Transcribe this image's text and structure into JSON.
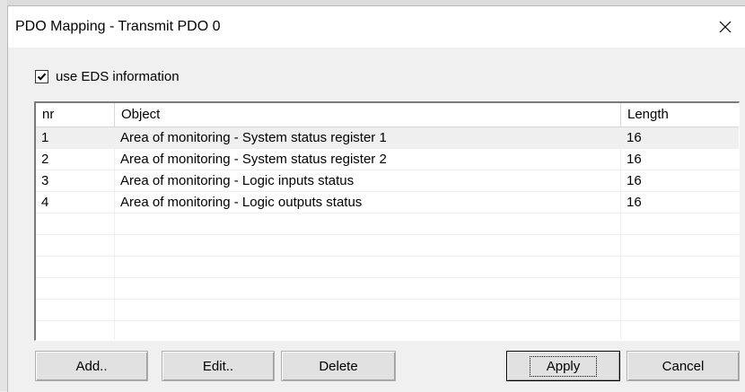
{
  "dialog": {
    "title": "PDO Mapping - Transmit PDO 0",
    "close_icon": "close-icon"
  },
  "options": {
    "use_eds_label": "use EDS information",
    "use_eds_checked": true
  },
  "table": {
    "columns": [
      "nr",
      "Object",
      "Length"
    ],
    "rows": [
      {
        "nr": "1",
        "object": "Area of monitoring - System status register 1",
        "length": "16"
      },
      {
        "nr": "2",
        "object": "Area of monitoring - System status register 2",
        "length": "16"
      },
      {
        "nr": "3",
        "object": "Area of monitoring - Logic inputs status",
        "length": "16"
      },
      {
        "nr": "4",
        "object": "Area of monitoring - Logic outputs status",
        "length": "16"
      }
    ],
    "selected_row": 1
  },
  "buttons": {
    "add": "Add..",
    "edit": "Edit..",
    "delete": "Delete",
    "apply": "Apply",
    "cancel": "Cancel"
  }
}
